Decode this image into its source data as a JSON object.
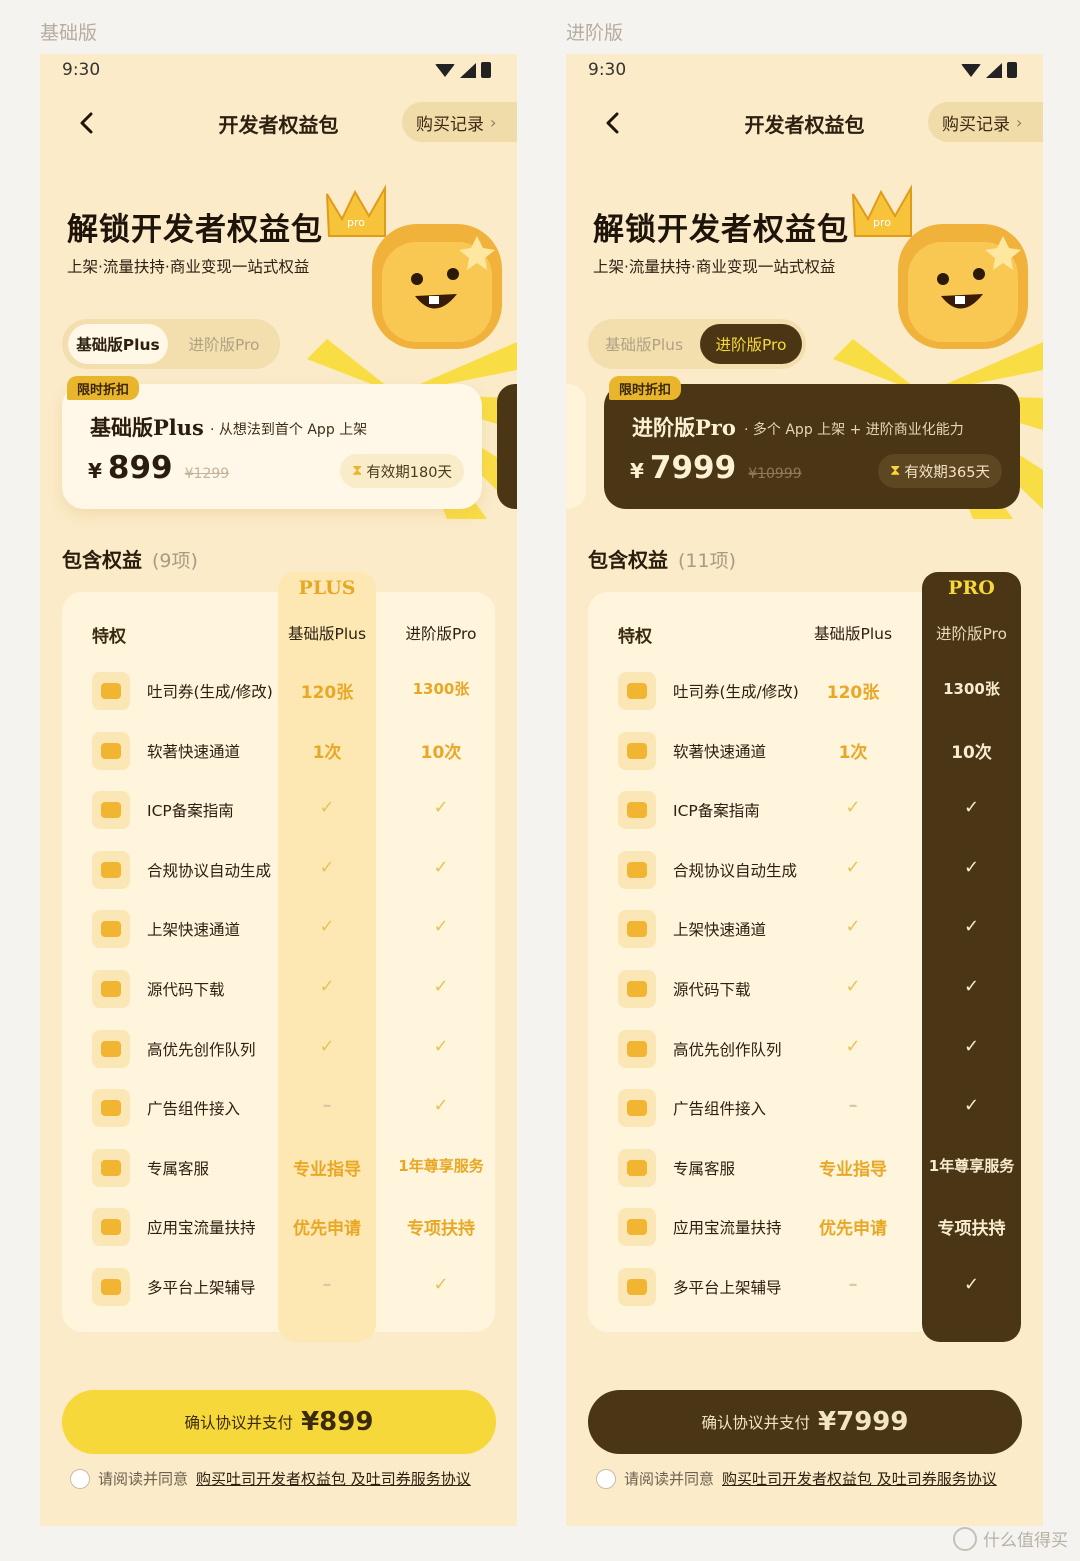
{
  "variants": [
    {
      "label": "基础版",
      "time": "9:30",
      "nav_title": "开发者权益包",
      "records_label": "购买记录",
      "hero_title": "解锁开发者权益包",
      "hero_sub": "上架·流量扶持·商业变现一站式权益",
      "mascot_badge": "pro",
      "tabs": [
        "基础版Plus",
        "进阶版Pro"
      ],
      "active_tab": 0,
      "sale_tag": "限时折扣",
      "plan_name": "基础版Plus",
      "plan_desc": "· 从想法到首个 App 上架",
      "currency": "¥",
      "price": "899",
      "orig_price": "¥1299",
      "validity": "有效期180天",
      "section_title": "包含权益",
      "section_count": "(9项)",
      "highlight_badge": "PLUS",
      "col_headers": [
        "特权",
        "基础版Plus",
        "进阶版Pro"
      ],
      "pay_label": "确认协议并支付",
      "pay_amount": "¥899",
      "agree_prefix": "请阅读并同意",
      "agree_link": "购买吐司开发者权益包 及吐司券服务协议"
    },
    {
      "label": "进阶版",
      "time": "9:30",
      "nav_title": "开发者权益包",
      "records_label": "购买记录",
      "hero_title": "解锁开发者权益包",
      "hero_sub": "上架·流量扶持·商业变现一站式权益",
      "mascot_badge": "pro",
      "tabs": [
        "基础版Plus",
        "进阶版Pro"
      ],
      "active_tab": 1,
      "sale_tag": "限时折扣",
      "plan_name": "进阶版Pro",
      "plan_desc": "· 多个 App 上架 + 进阶商业化能力",
      "currency": "¥",
      "price": "7999",
      "orig_price": "¥10999",
      "validity": "有效期365天",
      "section_title": "包含权益",
      "section_count": "(11项)",
      "highlight_badge": "PRO",
      "col_headers": [
        "特权",
        "基础版Plus",
        "进阶版Pro"
      ],
      "pay_label": "确认协议并支付",
      "pay_amount": "¥7999",
      "agree_prefix": "请阅读并同意",
      "agree_link": "购买吐司开发者权益包 及吐司券服务协议"
    }
  ],
  "rows": [
    {
      "label": "吐司券(生成/修改)",
      "plus": "120张",
      "pro": "1300张",
      "icon": "ticket-icon"
    },
    {
      "label": "软著快速通道",
      "plus": "1次",
      "pro": "10次",
      "icon": "lightning-icon"
    },
    {
      "label": "ICP备案指南",
      "plus": "✓",
      "pro": "✓",
      "icon": "clipboard-icon"
    },
    {
      "label": "合规协议自动生成",
      "plus": "✓",
      "pro": "✓",
      "icon": "document-icon"
    },
    {
      "label": "上架快速通道",
      "plus": "✓",
      "pro": "✓",
      "icon": "upload-cloud-icon"
    },
    {
      "label": "源代码下载",
      "plus": "✓",
      "pro": "✓",
      "icon": "code-file-icon"
    },
    {
      "label": "高优先创作队列",
      "plus": "✓",
      "pro": "✓",
      "icon": "team-icon"
    },
    {
      "label": "广告组件接入",
      "plus": "–",
      "pro": "✓",
      "icon": "puzzle-icon"
    },
    {
      "label": "专属客服",
      "plus": "专业指导",
      "pro": "1年尊享服务",
      "icon": "headset-icon"
    },
    {
      "label": "应用宝流量扶持",
      "plus": "优先申请",
      "pro": "专项扶持",
      "icon": "bar-chart-icon"
    },
    {
      "label": "多平台上架辅导",
      "plus": "–",
      "pro": "✓",
      "icon": "layers-icon"
    }
  ],
  "watermark": "什么值得买",
  "colors": {
    "bg": "#fbebc9",
    "accent_yellow": "#f7d43a",
    "dark_brown": "#4a3614",
    "gold_text": "#e8a825"
  }
}
